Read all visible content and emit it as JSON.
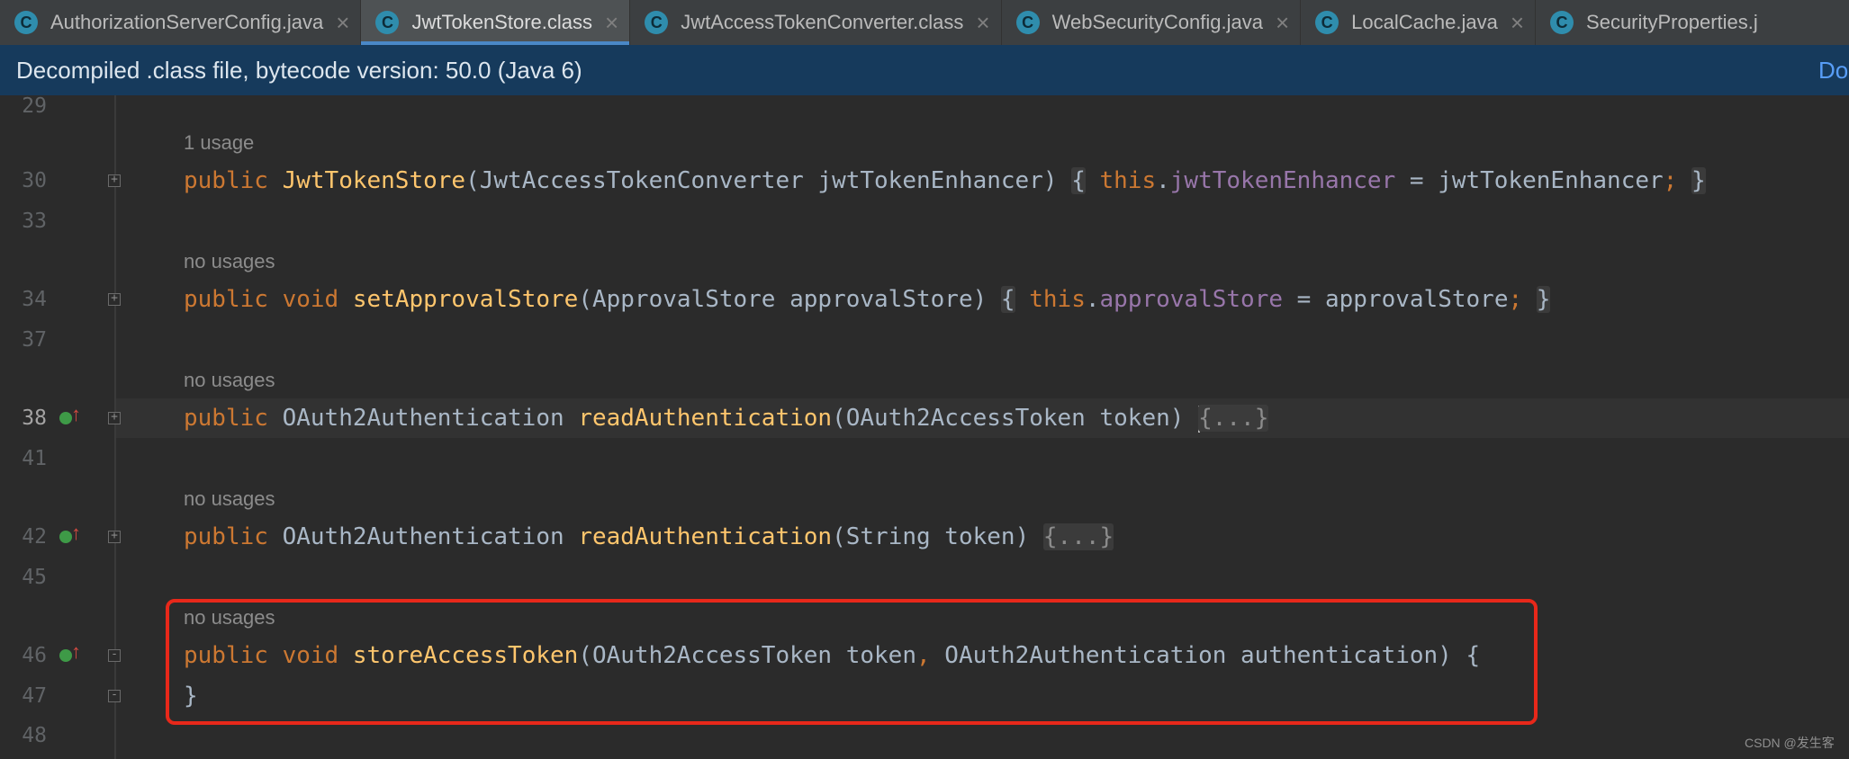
{
  "tabs": [
    {
      "label": "AuthorizationServerConfig.java",
      "icon": "class-icon",
      "active": false
    },
    {
      "label": "JwtTokenStore.class",
      "icon": "class-icon",
      "active": true
    },
    {
      "label": "JwtAccessTokenConverter.class",
      "icon": "class-icon",
      "active": false
    },
    {
      "label": "WebSecurityConfig.java",
      "icon": "class-icon",
      "active": false
    },
    {
      "label": "LocalCache.java",
      "icon": "class-icon",
      "active": false
    },
    {
      "label": "SecurityProperties.j",
      "icon": "class-icon",
      "active": false
    }
  ],
  "tab_icon_glyph": "C",
  "tab_close_glyph": "×",
  "banner": {
    "text": "Decompiled .class file, bytecode version: 50.0 (Java 6)",
    "link_text": "Do"
  },
  "line_numbers": [
    "29",
    "30",
    "33",
    "34",
    "37",
    "38",
    "41",
    "42",
    "45",
    "46",
    "47",
    "48"
  ],
  "hints": {
    "h30": "1 usage",
    "h34": "no usages",
    "h38": "no usages",
    "h42": "no usages",
    "h46": "no usages"
  },
  "code": {
    "l30": {
      "kw": "public",
      "name": "JwtTokenStore",
      "params": "(JwtAccessTokenConverter jwtTokenEnhancer)",
      "open": "{",
      "this": "this",
      "dot": ".",
      "field": "jwtTokenEnhancer",
      "rest": " = jwtTokenEnhancer",
      "semi": ";",
      "close": "}"
    },
    "l34": {
      "kw1": "public",
      "kw2": "void",
      "name": "setApprovalStore",
      "params": "(ApprovalStore approvalStore)",
      "open": "{",
      "this": "this",
      "dot": ".",
      "field": "approvalStore",
      "rest": " = approvalStore",
      "semi": ";",
      "close": "}"
    },
    "l38": {
      "kw": "public",
      "type": "OAuth2Authentication",
      "name": "readAuthentication",
      "params": "(OAuth2AccessToken token)",
      "folded": "{...}"
    },
    "l42": {
      "kw": "public",
      "type": "OAuth2Authentication",
      "name": "readAuthentication",
      "params": "(String token)",
      "folded": "{...}"
    },
    "l46": {
      "kw1": "public",
      "kw2": "void",
      "name": "storeAccessToken",
      "params1": "(OAuth2AccessToken token",
      "comma": ",",
      "params2": " OAuth2Authentication authentication) {"
    },
    "l47": {
      "text": "}"
    }
  },
  "watermark": "CSDN @发生客",
  "colors": {
    "keyword": "#cc7832",
    "method": "#ffc66d",
    "field": "#9876aa",
    "highlight_border": "#e8281a",
    "active_tab_underline": "#4a88c7"
  }
}
